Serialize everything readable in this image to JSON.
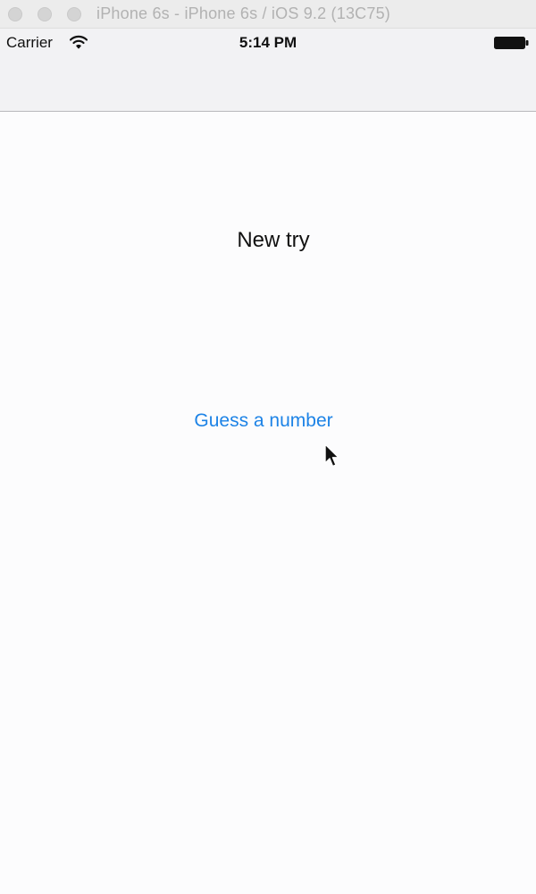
{
  "window": {
    "title": "iPhone 6s - iPhone 6s / iOS 9.2 (13C75)"
  },
  "status_bar": {
    "carrier": "Carrier",
    "time": "5:14 PM",
    "icons": [
      "wifi-icon",
      "battery-icon"
    ]
  },
  "main": {
    "label": "New try",
    "button_label": "Guess a number"
  },
  "colors": {
    "accent": "#1d83e6",
    "background": "#fcfcfd",
    "bar_background": "#f2f2f4",
    "text": "#111111"
  }
}
